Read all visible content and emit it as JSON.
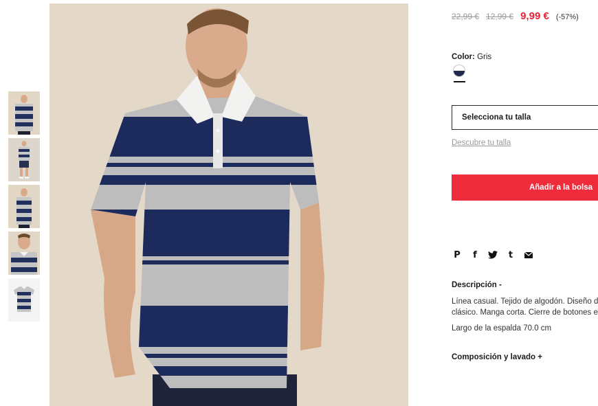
{
  "price": {
    "original": "22,99 €",
    "previous": "12,99 €",
    "current": "9,99 €",
    "discount": "(-57%)"
  },
  "color": {
    "label": "Color:",
    "value": "Gris"
  },
  "size": {
    "select_label": "Selecciona tu talla",
    "guide_link": "Descubre tu talla"
  },
  "cart": {
    "add_label": "Añadir a la bolsa"
  },
  "share": {
    "icons": [
      "pinterest-icon",
      "facebook-icon",
      "twitter-icon",
      "tumblr-icon",
      "email-icon"
    ],
    "glyphs": [
      "P",
      "f",
      "t",
      "t",
      "✉"
    ]
  },
  "description": {
    "title": "Descripción -",
    "line1": "Línea casual. Tejido de algodón. Diseño d",
    "line2": "clásico. Manga corta. Cierre de botones e",
    "measure": "Largo de la espalda 70.0 cm"
  },
  "composition": {
    "title": "Composición y lavado +"
  },
  "colors": {
    "sale_red": "#e51f35",
    "button_red": "#ef2c3b",
    "navy": "#1d2a5c",
    "grey_stripe": "#b9b9b9",
    "background_beige": "#e4d9c9"
  }
}
